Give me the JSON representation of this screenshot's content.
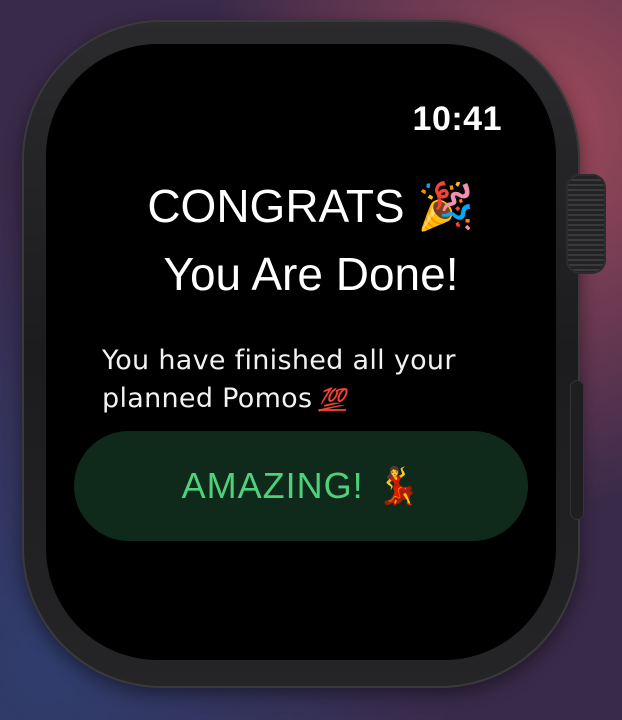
{
  "status": {
    "time": "10:41"
  },
  "congrats": {
    "line1": "CONGRATS",
    "line1_emoji": "🎉",
    "line2": "You Are Done!"
  },
  "message": {
    "line1": "You have finished all your",
    "line2": "planned Pomos",
    "line2_emoji": "💯"
  },
  "action": {
    "label": "AMAZING!",
    "emoji": "💃"
  },
  "colors": {
    "button_text": "#4fd07a",
    "button_background": "#0f2a1b",
    "screen_background": "#000000"
  }
}
